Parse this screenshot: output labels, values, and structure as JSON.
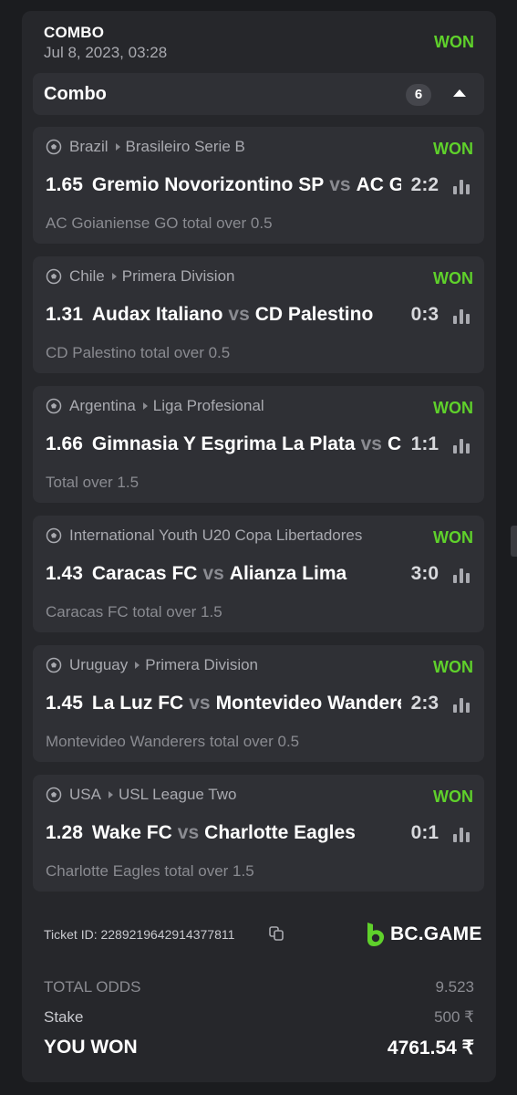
{
  "colors": {
    "accent_green": "#5fd12b",
    "background": "#1b1c1f",
    "card": "#26272b",
    "panel": "#2f3035"
  },
  "header": {
    "type": "COMBO",
    "date": "Jul 8, 2023, 03:28",
    "status": "WON"
  },
  "combo": {
    "title": "Combo",
    "count": "6",
    "toggle_icon": "caret-up-icon"
  },
  "bets": [
    {
      "country": "Brazil",
      "league": "Brasileiro Serie B",
      "status": "WON",
      "odds": "1.65",
      "home": "Gremio Novorizontino SP",
      "vs": "vs",
      "away": "AC Goianiense GO",
      "score": "2:2",
      "market": "AC Goianiense GO total over 0.5"
    },
    {
      "country": "Chile",
      "league": "Primera Division",
      "status": "WON",
      "odds": "1.31",
      "home": "Audax Italiano",
      "vs": "vs",
      "away": "CD Palestino",
      "score": "0:3",
      "market": "CD Palestino total over 0.5"
    },
    {
      "country": "Argentina",
      "league": "Liga Profesional",
      "status": "WON",
      "odds": "1.66",
      "home": "Gimnasia Y Esgrima La Plata",
      "vs": "vs",
      "away": "CA",
      "score": "1:1",
      "market": "Total over 1.5"
    },
    {
      "country": "International Youth U20 Copa Libertadores",
      "league": "",
      "status": "WON",
      "odds": "1.43",
      "home": "Caracas FC",
      "vs": "vs",
      "away": "Alianza Lima",
      "score": "3:0",
      "market": "Caracas FC total over 1.5"
    },
    {
      "country": "Uruguay",
      "league": "Primera Division",
      "status": "WON",
      "odds": "1.45",
      "home": "La Luz FC",
      "vs": "vs",
      "away": "Montevideo Wanderers",
      "score": "2:3",
      "market": "Montevideo Wanderers total over 0.5"
    },
    {
      "country": "USA",
      "league": "USL League Two",
      "status": "WON",
      "odds": "1.28",
      "home": "Wake FC",
      "vs": "vs",
      "away": "Charlotte Eagles",
      "score": "0:1",
      "market": "Charlotte Eagles total over 1.5"
    }
  ],
  "ticket": {
    "label": "Ticket ID: 2289219642914377811"
  },
  "brand": {
    "name": "BC.GAME"
  },
  "summary": {
    "total_odds_label": "TOTAL ODDS",
    "total_odds": "9.523",
    "stake_label": "Stake",
    "stake": "500 ₹",
    "won_label": "YOU WON",
    "won": "4761.54 ₹"
  }
}
